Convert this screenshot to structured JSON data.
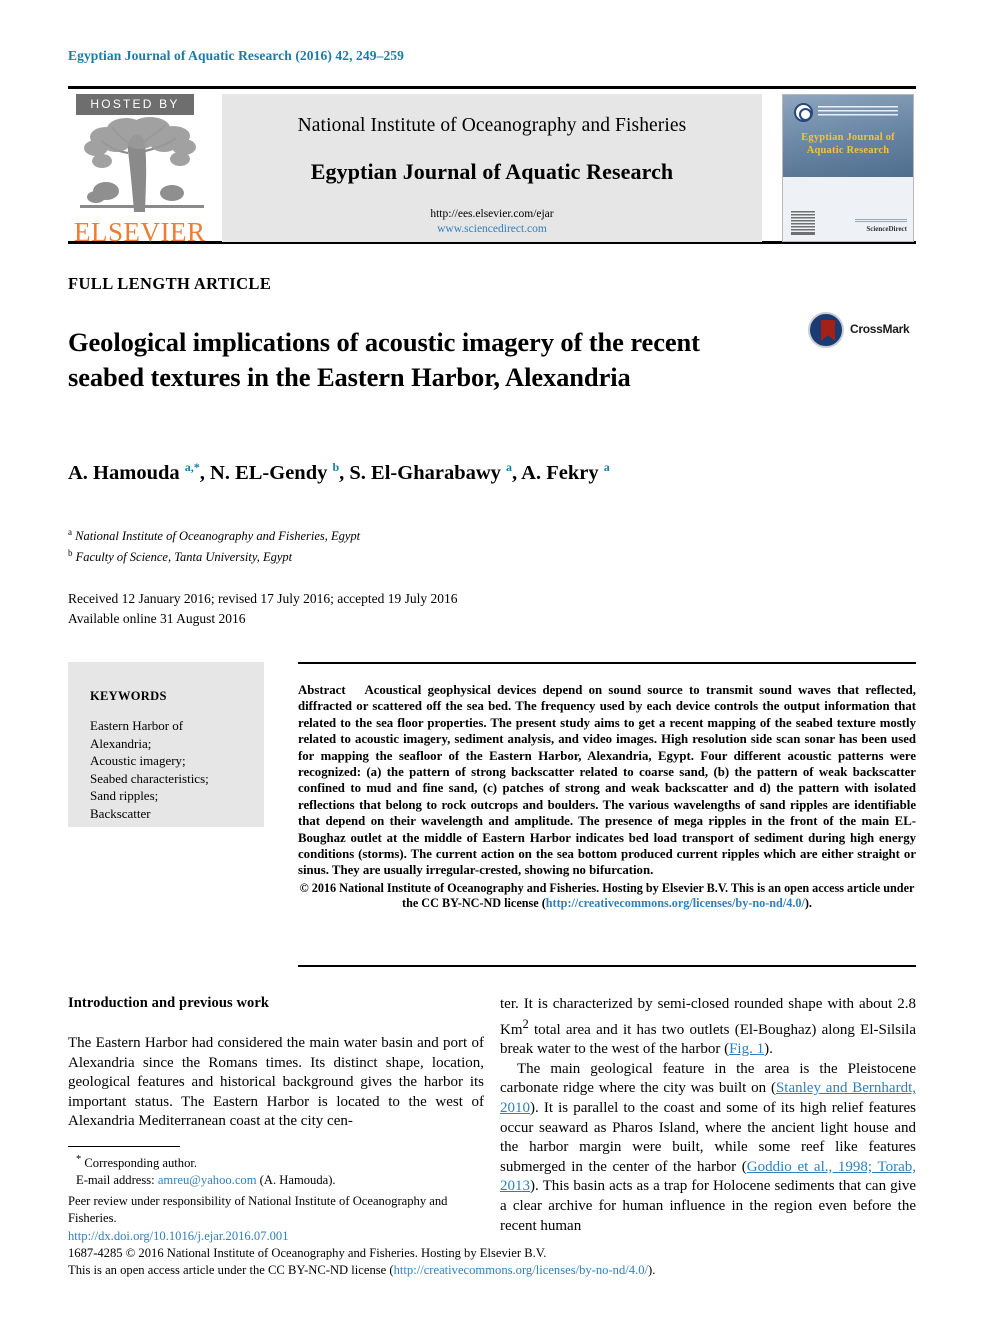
{
  "running_head": "Egyptian Journal of Aquatic Research (2016) 42, 249–259",
  "masthead": {
    "hosted_by": "HOSTED BY",
    "publisher_wordmark": "ELSEVIER",
    "institute": "National Institute of Oceanography and Fisheries",
    "journal_title": "Egyptian Journal of Aquatic Research",
    "url_submission": "http://ees.elsevier.com/ejar",
    "url_sciencedirect": "www.sciencedirect.com",
    "cover": {
      "title_line1": "Egyptian Journal of",
      "title_line2": "Aquatic Research",
      "brand": "ScienceDirect"
    }
  },
  "article": {
    "type_label": "FULL LENGTH ARTICLE",
    "title": "Geological implications of acoustic imagery of the recent seabed textures in the Eastern Harbor, Alexandria",
    "crossmark_label": "CrossMark",
    "authors_html": "A. Hamouda <sup class=\"star\">a,*</sup>, N. EL-Gendy <sup>b</sup>, S. El-Gharabawy <sup>a</sup>, A. Fekry <sup>a</sup>",
    "affiliation_a": "National Institute of Oceanography and Fisheries, Egypt",
    "affiliation_b": "Faculty of Science, Tanta University, Egypt",
    "received_line": "Received 12 January 2016; revised 17 July 2016; accepted 19 July 2016",
    "available_line": "Available online 31 August 2016"
  },
  "keywords": {
    "heading": "KEYWORDS",
    "items": [
      "Eastern Harbor of",
      "Alexandria;",
      "Acoustic imagery;",
      "Seabed characteristics;",
      "Sand ripples;",
      "Backscatter"
    ]
  },
  "abstract": {
    "label": "Abstract",
    "text": "Acoustical geophysical devices depend on sound source to transmit sound waves that reflected, diffracted or scattered off the sea bed. The frequency used by each device controls the output information that related to the sea floor properties. The present study aims to get a recent mapping of the seabed texture mostly related to acoustic imagery, sediment analysis, and video images. High resolution side scan sonar has been used for mapping the seafloor of the Eastern Harbor, Alexandria, Egypt. Four different acoustic patterns were recognized: (a) the pattern of strong backscatter related to coarse sand, (b) the pattern of weak backscatter confined to mud and fine sand, (c) patches of strong and weak backscatter and d) the pattern with isolated reflections that belong to rock outcrops and boulders. The various wavelengths of sand ripples are identifiable that depend on their wavelength and amplitude. The presence of mega ripples in the front of the main EL-Boughaz outlet at the middle of Eastern Harbor indicates bed load transport of sediment during high energy conditions (storms). The current action on the sea bottom produced current ripples which are either straight or sinus. They are usually irregular-crested, showing no bifurcation.",
    "copyright_part1": "© 2016 National Institute of Oceanography and Fisheries. Hosting by Elsevier B.V. This is an open access article under the CC BY-NC-ND license (",
    "copyright_link": "http://creativecommons.org/licenses/by-no-nd/4.0/",
    "copyright_part2": ")."
  },
  "body": {
    "heading": "Introduction and previous work",
    "left_paragraph": "The Eastern Harbor had considered the main water basin and port of Alexandria since the Romans times. Its distinct shape, location, geological features and historical background gives the harbor its important status. The Eastern Harbor is located to the west of Alexandria Mediterranean coast at the city cen-",
    "right_paragraph_1_pre": "ter. It is characterized by semi-closed rounded shape with about 2.8 Km",
    "right_paragraph_1_sup": "2",
    "right_paragraph_1_mid": " total area and it has two outlets (El-Boughaz) along El-Silsila break water to the west of the harbor (",
    "right_paragraph_1_cite": "Fig. 1",
    "right_paragraph_1_post": ").",
    "right_paragraph_2_pre": "The main geological feature in the area is the Pleistocene carbonate ridge where the city was built on (",
    "right_paragraph_2_cite1": "Stanley and Bernhardt, 2010",
    "right_paragraph_2_mid": "). It is parallel to the coast and some of its high relief features occur seaward as Pharos Island, where the ancient light house and the harbor margin were built, while some reef like features submerged in the center of the harbor (",
    "right_paragraph_2_cite2": "Goddio et al., 1998; Torab, 2013",
    "right_paragraph_2_post": "). This basin acts as a trap for Holocene sediments that can give a clear archive for human influence in the region even before the recent human"
  },
  "footnotes": {
    "corresponding": "Corresponding author.",
    "email_label": "E-mail address:",
    "email": "amreu@yahoo.com",
    "email_suffix": "(A. Hamouda).",
    "peer_review": "Peer review under responsibility of National Institute of Oceanography and Fisheries."
  },
  "footer": {
    "doi": "http://dx.doi.org/10.1016/j.ejar.2016.07.001",
    "issn_line": "1687-4285 © 2016 National Institute of Oceanography and Fisheries. Hosting by Elsevier B.V.",
    "license_pre": "This is an open access article under the CC BY-NC-ND license (",
    "license_link": "http://creativecommons.org/licenses/by-no-nd/4.0/",
    "license_post": ")."
  }
}
